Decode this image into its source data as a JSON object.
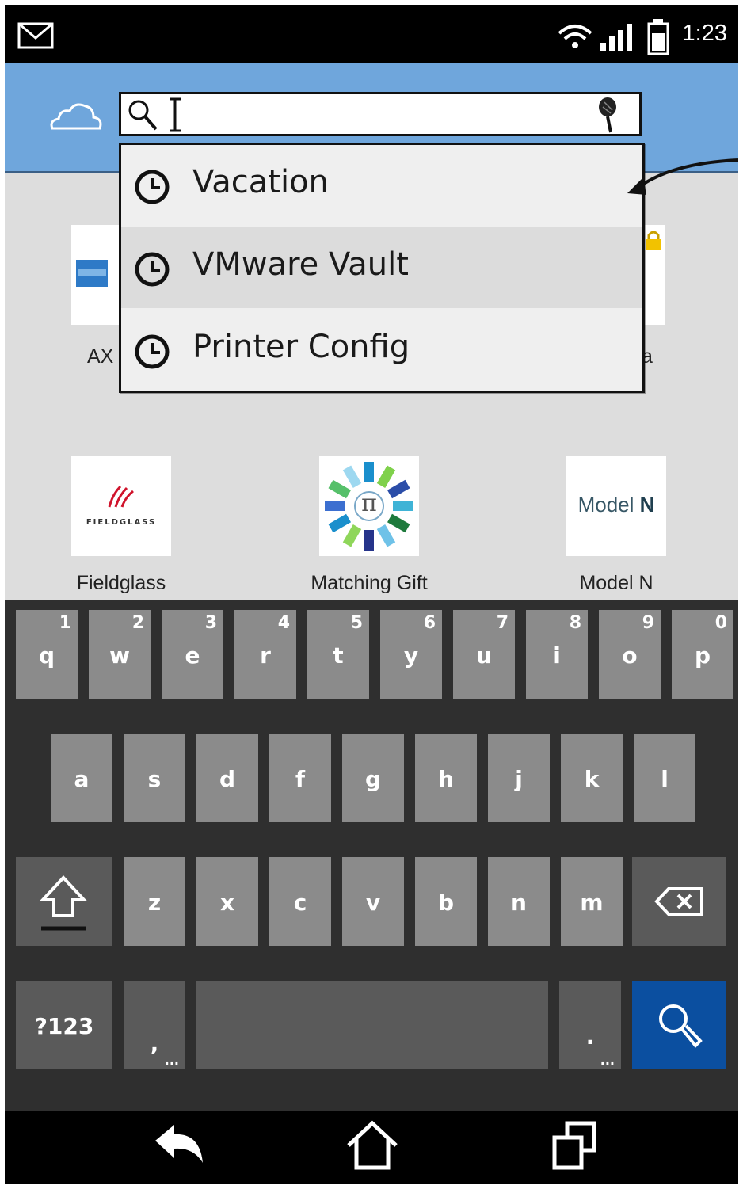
{
  "status_bar": {
    "time": "1:23",
    "icons": [
      "mail-icon",
      "wifi-icon",
      "signal-icon",
      "battery-icon"
    ]
  },
  "app_bar": {
    "logo_icon": "cloud-icon",
    "search": {
      "value": "",
      "placeholder": "",
      "left_icon": "search-icon",
      "right_icon": "microphone-icon"
    }
  },
  "suggestions": [
    {
      "label": "Vacation",
      "icon": "clock-icon",
      "highlighted": false
    },
    {
      "label": "VMware Vault",
      "icon": "clock-icon",
      "highlighted": true
    },
    {
      "label": "Printer Config",
      "icon": "clock-icon",
      "highlighted": false
    }
  ],
  "apps_row1": {
    "left_label_partial": "AX",
    "right_label_partial": "a"
  },
  "apps_row2": [
    {
      "label": "Fieldglass",
      "logo_text": "FIELDGLASS"
    },
    {
      "label": "Matching Gift",
      "logo_text": "π"
    },
    {
      "label": "Model N",
      "logo_text_a": "Model ",
      "logo_text_b": "N"
    }
  ],
  "keyboard": {
    "row1": [
      {
        "key": "q",
        "num": "1"
      },
      {
        "key": "w",
        "num": "2"
      },
      {
        "key": "e",
        "num": "3"
      },
      {
        "key": "r",
        "num": "4"
      },
      {
        "key": "t",
        "num": "5"
      },
      {
        "key": "y",
        "num": "6"
      },
      {
        "key": "u",
        "num": "7"
      },
      {
        "key": "i",
        "num": "8"
      },
      {
        "key": "o",
        "num": "9"
      },
      {
        "key": "p",
        "num": "0"
      }
    ],
    "row2": [
      "a",
      "s",
      "d",
      "f",
      "g",
      "h",
      "j",
      "k",
      "l"
    ],
    "row3": [
      "z",
      "x",
      "c",
      "v",
      "b",
      "n",
      "m"
    ],
    "symbols_label": "?123",
    "comma_label": ",",
    "period_label": ".",
    "more_dots": "...",
    "colors": {
      "key": "#8b8b8b",
      "dark_key": "#5a5a5a",
      "search_key": "#0b4fa0",
      "background": "#2f2f2f"
    }
  },
  "nav_bar": {
    "icons": [
      "back-icon",
      "home-icon",
      "recents-icon"
    ]
  },
  "colors": {
    "app_bar": "#6fa6dc",
    "content": "#dddddd"
  }
}
